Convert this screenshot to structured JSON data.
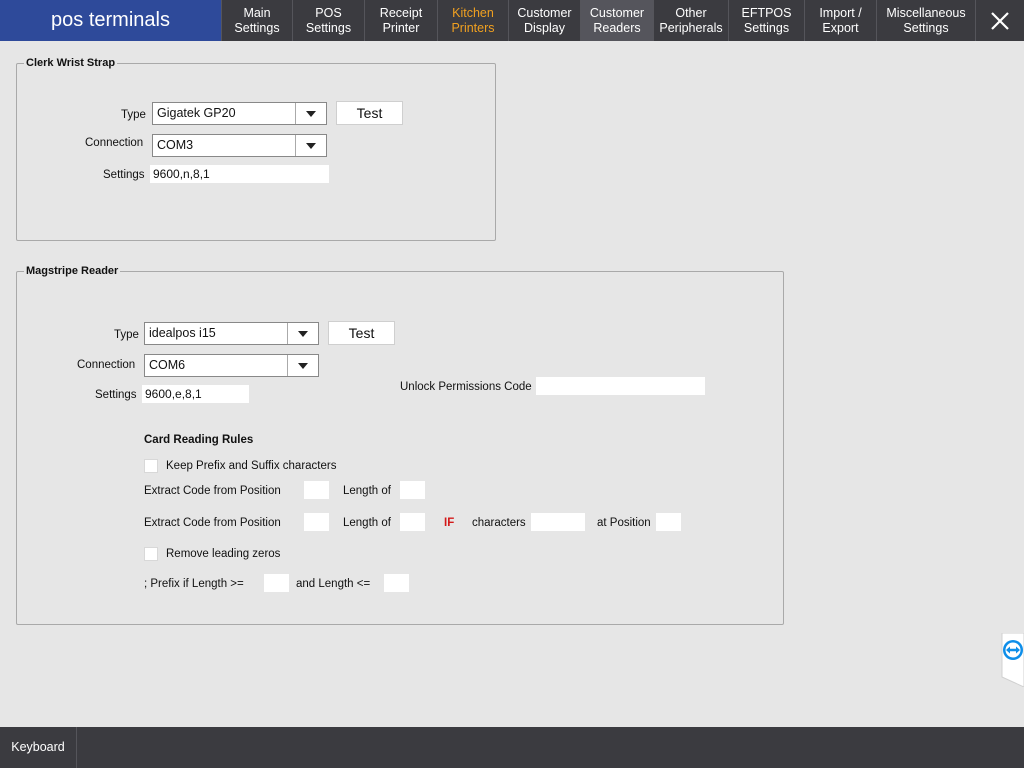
{
  "app": {
    "title": "pos terminals"
  },
  "tabs": [
    {
      "label": "Main\nSettings"
    },
    {
      "label": "POS\nSettings"
    },
    {
      "label": "Receipt\nPrinter"
    },
    {
      "label": "Kitchen\nPrinters"
    },
    {
      "label": "Customer\nDisplay"
    },
    {
      "label": "Customer\nReaders"
    },
    {
      "label": "Other\nPeripherals"
    },
    {
      "label": "EFTPOS\nSettings"
    },
    {
      "label": "Import /\nExport"
    },
    {
      "label": "Miscellaneous\nSettings"
    }
  ],
  "active_tab": "Customer Readers",
  "clerk": {
    "title": "Clerk Wrist Strap",
    "type_label": "Type",
    "type_value": "Gigatek GP20",
    "test_label": "Test",
    "connection_label": "Connection",
    "connection_value": "COM3",
    "settings_label": "Settings",
    "settings_value": "9600,n,8,1"
  },
  "magstripe": {
    "title": "Magstripe Reader",
    "type_label": "Type",
    "type_value": "idealpos i15",
    "test_label": "Test",
    "connection_label": "Connection",
    "connection_value": "COM6",
    "settings_label": "Settings",
    "settings_value": "9600,e,8,1",
    "unlock_label": "Unlock Permissions Code",
    "unlock_value": "",
    "rules_title": "Card Reading Rules",
    "keep_prefix_label": "Keep Prefix and Suffix characters",
    "extract_label": "Extract Code from Position",
    "length_of_label": "Length of",
    "if_label": "IF",
    "characters_label": "characters",
    "at_position_label": "at Position",
    "remove_zeros_label": "Remove leading zeros",
    "prefix_label": "; Prefix if Length >=",
    "and_length_label": "and Length <="
  },
  "footer": {
    "keyboard_label": "Keyboard"
  },
  "colors": {
    "brand": "#2e4a9a",
    "topbar": "#3b3b40",
    "active_tab": "#55555c",
    "kitchen_tab_text": "#f0a020",
    "if_text": "#d31a1a",
    "background": "#e6e6e6"
  }
}
